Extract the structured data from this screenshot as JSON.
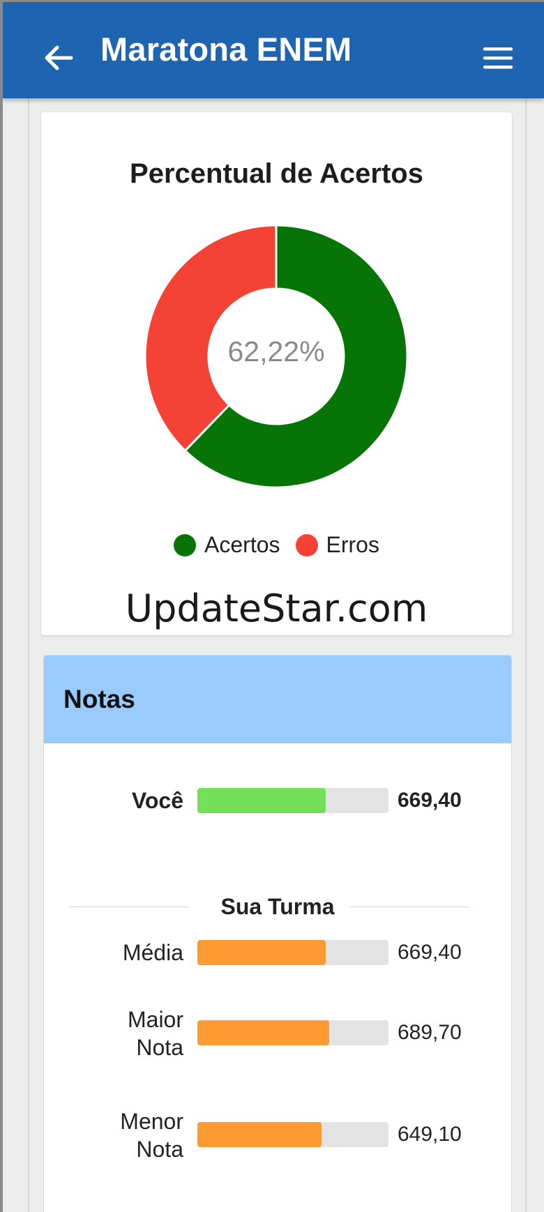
{
  "appbar": {
    "title": "Maratona ENEM",
    "back_icon": "arrow-left-icon",
    "menu_icon": "hamburger-menu-icon",
    "color": "#1f64b0"
  },
  "chart_data": {
    "type": "pie",
    "title": "Percentual de Acertos",
    "center_label": "62,22%",
    "categories": [
      "Acertos",
      "Erros"
    ],
    "values": [
      62.22,
      37.78
    ],
    "colors": [
      "#067406",
      "#f44336"
    ],
    "legend_position": "bottom"
  },
  "legend": {
    "items": [
      {
        "label": "Acertos",
        "color": "#067406"
      },
      {
        "label": "Erros",
        "color": "#f44336"
      }
    ]
  },
  "watermark": "UpdateStar.com",
  "notas": {
    "title": "Notas",
    "header_color": "#99cbff",
    "voce": {
      "label": "Você",
      "value": "669,40",
      "fill": 0.67,
      "color": "#74e05a"
    },
    "divider_label": "Sua Turma",
    "turma": [
      {
        "label": "Média",
        "value": "669,40",
        "fill": 0.67,
        "color": "#fe9a32"
      },
      {
        "label": "Maior\nNota",
        "value": "689,70",
        "fill": 0.69,
        "color": "#fe9a32"
      },
      {
        "label": "Menor\nNota",
        "value": "649,10",
        "fill": 0.65,
        "color": "#fe9a32"
      }
    ]
  }
}
